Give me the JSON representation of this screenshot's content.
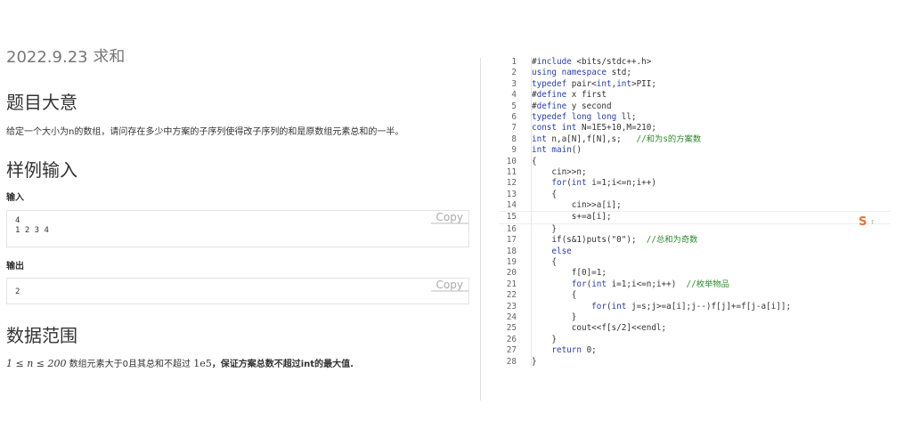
{
  "left": {
    "date": "2022.9.23 求和",
    "h_problem": "题目大意",
    "problem_text": "给定一个大小为n的数组，请问存在多少中方案的子序列使得改子序列的和是原数组元素总和的一半。",
    "h_sample": "样例输入",
    "input_label": "输入",
    "input_lines": [
      "4",
      "1 2 3 4"
    ],
    "output_label": "输出",
    "output_lines": [
      "2"
    ],
    "copy_label": "Copy",
    "h_range": "数据范围",
    "range_math1": "1 ≤ n ≤ 200",
    "range_text": " 数组元素大于0且其总和不超过 ",
    "range_math2": "1e5",
    "range_bold": "，保证方案总数不超过int的最大值."
  },
  "code": [
    "#include <bits/stdc++.h>",
    "using namespace std;",
    "typedef pair<int,int>PII;",
    "#define x first",
    "#define y second",
    "typedef long long ll;",
    "const int N=1E5+10,M=210;",
    "int n,a[N],f[N],s;   //和为s的方案数",
    "int main()",
    "{",
    "    cin>>n;",
    "    for(int i=1;i<=n;i++)",
    "    {",
    "        cin>>a[i];",
    "        s+=a[i];",
    "    }",
    "    if(s&1)puts(\"0\");  //总和为奇数",
    "    else",
    "    {",
    "        f[0]=1;",
    "        for(int i=1;i<=n;i++)  //枚举物品",
    "        {",
    "            for(int j=s;j>=a[i];j--)f[j]+=f[j-a[i]];",
    "        }",
    "        cout<<f[s/2]<<endl;",
    "    }",
    "    return 0;",
    "}"
  ],
  "ime": {
    "logo": "S",
    "dots": "⠆"
  }
}
